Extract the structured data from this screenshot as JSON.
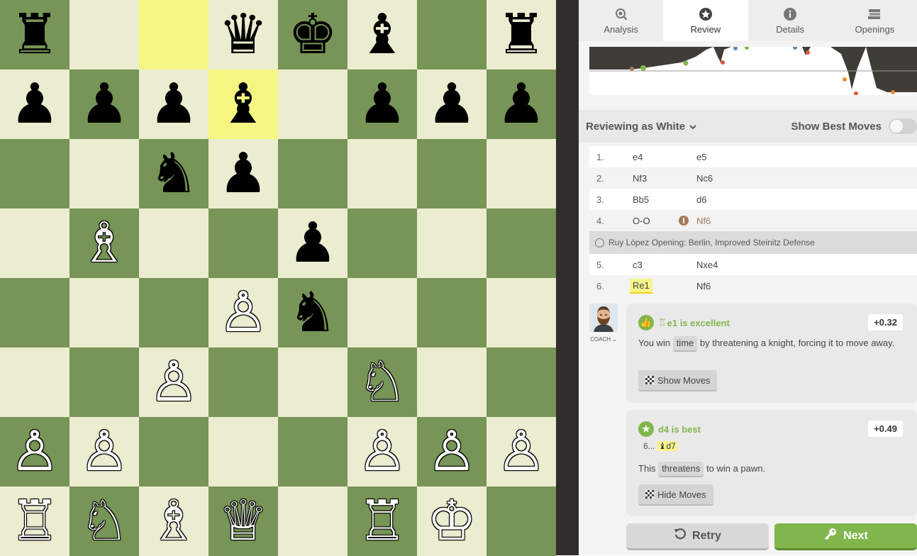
{
  "board": {
    "colors": {
      "light": "#ebecd0",
      "dark": "#779556",
      "highlight": "#f5f682"
    },
    "highlighted_squares": [
      "c8",
      "d7"
    ],
    "pieces": [
      {
        "square": "a8",
        "piece": "♜",
        "color": "b",
        "name": "black-rook"
      },
      {
        "square": "d8",
        "piece": "♛",
        "color": "b",
        "name": "black-queen"
      },
      {
        "square": "e8",
        "piece": "♚",
        "color": "b",
        "name": "black-king"
      },
      {
        "square": "f8",
        "piece": "♝",
        "color": "b",
        "name": "black-bishop"
      },
      {
        "square": "h8",
        "piece": "♜",
        "color": "b",
        "name": "black-rook"
      },
      {
        "square": "a7",
        "piece": "♟",
        "color": "b",
        "name": "black-pawn"
      },
      {
        "square": "b7",
        "piece": "♟",
        "color": "b",
        "name": "black-pawn"
      },
      {
        "square": "c7",
        "piece": "♟",
        "color": "b",
        "name": "black-pawn"
      },
      {
        "square": "d7",
        "piece": "♝",
        "color": "b",
        "name": "black-bishop"
      },
      {
        "square": "f7",
        "piece": "♟",
        "color": "b",
        "name": "black-pawn"
      },
      {
        "square": "g7",
        "piece": "♟",
        "color": "b",
        "name": "black-pawn"
      },
      {
        "square": "h7",
        "piece": "♟",
        "color": "b",
        "name": "black-pawn"
      },
      {
        "square": "c6",
        "piece": "♞",
        "color": "b",
        "name": "black-knight"
      },
      {
        "square": "d6",
        "piece": "♟",
        "color": "b",
        "name": "black-pawn"
      },
      {
        "square": "b5",
        "piece": "♗",
        "color": "w",
        "name": "white-bishop"
      },
      {
        "square": "e5",
        "piece": "♟",
        "color": "b",
        "name": "black-pawn"
      },
      {
        "square": "d4",
        "piece": "♙",
        "color": "w",
        "name": "white-pawn"
      },
      {
        "square": "e4",
        "piece": "♞",
        "color": "b",
        "name": "black-knight"
      },
      {
        "square": "c3",
        "piece": "♙",
        "color": "w",
        "name": "white-pawn"
      },
      {
        "square": "f3",
        "piece": "♘",
        "color": "w",
        "name": "white-knight"
      },
      {
        "square": "a2",
        "piece": "♙",
        "color": "w",
        "name": "white-pawn"
      },
      {
        "square": "b2",
        "piece": "♙",
        "color": "w",
        "name": "white-pawn"
      },
      {
        "square": "f2",
        "piece": "♙",
        "color": "w",
        "name": "white-pawn"
      },
      {
        "square": "g2",
        "piece": "♙",
        "color": "w",
        "name": "white-pawn"
      },
      {
        "square": "h2",
        "piece": "♙",
        "color": "w",
        "name": "white-pawn"
      },
      {
        "square": "a1",
        "piece": "♖",
        "color": "w",
        "name": "white-rook"
      },
      {
        "square": "b1",
        "piece": "♘",
        "color": "w",
        "name": "white-knight"
      },
      {
        "square": "c1",
        "piece": "♗",
        "color": "w",
        "name": "white-bishop"
      },
      {
        "square": "d1",
        "piece": "♕",
        "color": "w",
        "name": "white-queen"
      },
      {
        "square": "f1",
        "piece": "♖",
        "color": "w",
        "name": "white-rook"
      },
      {
        "square": "g1",
        "piece": "♔",
        "color": "w",
        "name": "white-king"
      }
    ]
  },
  "tabs": [
    {
      "label": "Analysis",
      "icon": "analysis-icon",
      "active": false
    },
    {
      "label": "Review",
      "icon": "star-icon",
      "active": true
    },
    {
      "label": "Details",
      "icon": "info-icon",
      "active": false
    },
    {
      "label": "Openings",
      "icon": "book-stack-icon",
      "active": false
    }
  ],
  "review_bar": {
    "reviewing_label": "Reviewing as White",
    "show_best_label": "Show Best Moves",
    "show_best_enabled": false
  },
  "moves": [
    {
      "num": "1.",
      "white": "e4",
      "black": "e5"
    },
    {
      "num": "2.",
      "white": "Nf3",
      "black": "Nc6"
    },
    {
      "num": "3.",
      "white": "Bb5",
      "black": "d6"
    },
    {
      "num": "4.",
      "white": "O-O",
      "black": "Nf6",
      "black_book": true
    }
  ],
  "opening_name": "Ruy López Opening: Berlin, Improved Steinitz Defense",
  "moves_after": [
    {
      "num": "5.",
      "white": "c3",
      "black": "Nxe4"
    },
    {
      "num": "6.",
      "white": "Re1",
      "black": "Nf6",
      "white_highlight": true
    }
  ],
  "coach": {
    "label": "COACH"
  },
  "card1": {
    "title": "e1 is excellent",
    "title_piece": "♖",
    "eval": "+0.32",
    "text_before": "You win",
    "chip": "time",
    "text_after": "by threatening a knight, forcing it to move away.",
    "button": "Show Moves",
    "accent": "#81b64c"
  },
  "card2": {
    "title": "d4 is best",
    "eval": "+0.49",
    "line_num": "6...",
    "line_piece": "♝",
    "line_move": "d7",
    "text_before": "This",
    "chip": "threatens",
    "text_after": "to win a pawn.",
    "button": "Hide Moves"
  },
  "buttons": {
    "retry": "Retry",
    "next": "Next",
    "next_color": "#81b64c"
  }
}
